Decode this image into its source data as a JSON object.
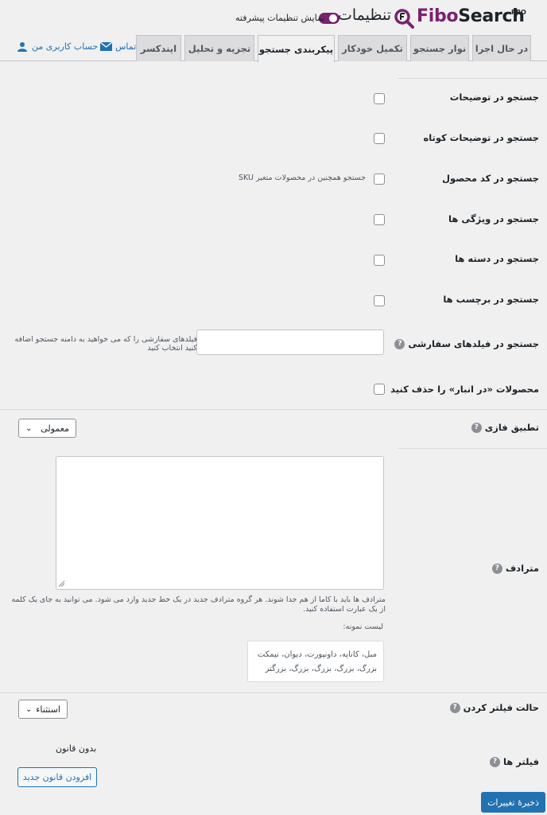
{
  "header": {
    "brand_fibo": "Fibo",
    "brand_search": "Search",
    "pro_badge": "PRO",
    "settings_title": "تنظیمات",
    "advanced_toggle_label": "نمایش تنظیمات پیشرفته",
    "accent_color": "#7a2170"
  },
  "tabs": [
    {
      "label": "در حال اجرا",
      "active": false
    },
    {
      "label": "نوار جستجو",
      "active": false
    },
    {
      "label": "تکمیل خودکار",
      "active": false
    },
    {
      "label": "پیکربندی جستجو",
      "active": true
    },
    {
      "label": "تجزیه و تحلیل",
      "active": false
    },
    {
      "label": "ایندکسر",
      "active": false
    }
  ],
  "toplinks": {
    "contact": "تماس",
    "account": "حساب کاربری من"
  },
  "rows": {
    "desc": "جستجو در توضیحات",
    "short_desc": "جستجو در توضیحات کوتاه",
    "sku": "جستجو در کد محصول",
    "sku_variants": "جستجو همچنین در محصولات متغیر SKU",
    "attributes": "جستجو در ویژگی ها",
    "categories": "جستجو در دسته ها",
    "tags": "جستجو در برچسب ها",
    "custom_fields": "جستجو در فیلدهای سفارشی",
    "custom_fields_placeholder": "فیلدهای سفارشی را که می خواهید به دامنه جستجو اضافه کنید انتخاب کنید",
    "exclude_out_of_stock": "محصولات «در انبار» را حذف کنید",
    "fuzzy": "تطبیق فازی",
    "fuzzy_value": "معمولی",
    "synonyms": "مترادف",
    "synonyms_help": "مترادف ها باید با کاما از هم جدا شوند. هر گروه مترادف جدید در یک خط جدید وارد می شود. می توانید به جای یک کلمه از یک عبارت استفاده کنید.",
    "example_title": "لیست نمونه:",
    "example_line1": "مبل، کاناپه، داونپورت، دیوان، نیمکت",
    "example_line2": "بزرگ، بزرگ، بزرگ، بزرگ، بزرگتر",
    "filter_mode": "حالت فیلتر کردن",
    "filter_mode_value": "استثناء",
    "filters": "فیلتر ها",
    "no_rules": "بدون قانون",
    "add_rule": "افزودن قانون جدید",
    "save": "ذخیرهٔ تغییرات"
  }
}
